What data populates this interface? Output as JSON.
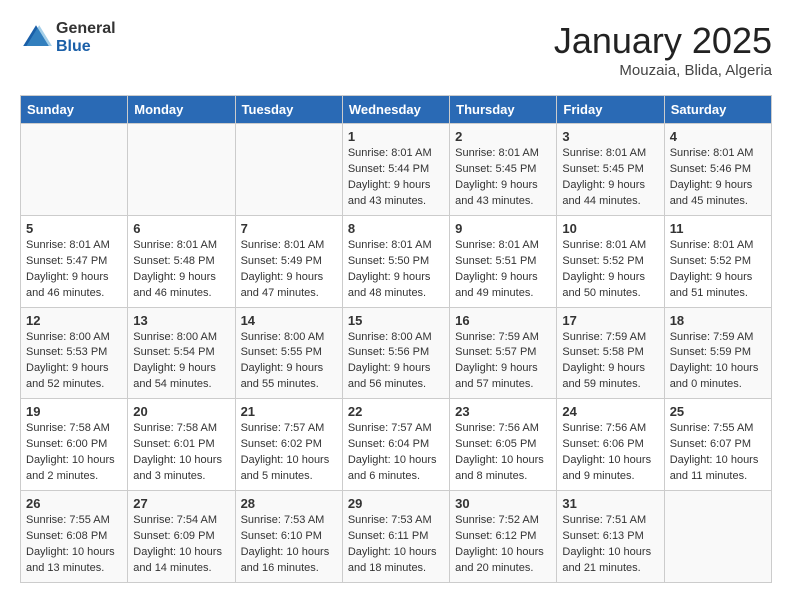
{
  "header": {
    "logo_general": "General",
    "logo_blue": "Blue",
    "title": "January 2025",
    "location": "Mouzaia, Blida, Algeria"
  },
  "days_of_week": [
    "Sunday",
    "Monday",
    "Tuesday",
    "Wednesday",
    "Thursday",
    "Friday",
    "Saturday"
  ],
  "weeks": [
    [
      {
        "day": "",
        "content": ""
      },
      {
        "day": "",
        "content": ""
      },
      {
        "day": "",
        "content": ""
      },
      {
        "day": "1",
        "content": "Sunrise: 8:01 AM\nSunset: 5:44 PM\nDaylight: 9 hours\nand 43 minutes."
      },
      {
        "day": "2",
        "content": "Sunrise: 8:01 AM\nSunset: 5:45 PM\nDaylight: 9 hours\nand 43 minutes."
      },
      {
        "day": "3",
        "content": "Sunrise: 8:01 AM\nSunset: 5:45 PM\nDaylight: 9 hours\nand 44 minutes."
      },
      {
        "day": "4",
        "content": "Sunrise: 8:01 AM\nSunset: 5:46 PM\nDaylight: 9 hours\nand 45 minutes."
      }
    ],
    [
      {
        "day": "5",
        "content": "Sunrise: 8:01 AM\nSunset: 5:47 PM\nDaylight: 9 hours\nand 46 minutes."
      },
      {
        "day": "6",
        "content": "Sunrise: 8:01 AM\nSunset: 5:48 PM\nDaylight: 9 hours\nand 46 minutes."
      },
      {
        "day": "7",
        "content": "Sunrise: 8:01 AM\nSunset: 5:49 PM\nDaylight: 9 hours\nand 47 minutes."
      },
      {
        "day": "8",
        "content": "Sunrise: 8:01 AM\nSunset: 5:50 PM\nDaylight: 9 hours\nand 48 minutes."
      },
      {
        "day": "9",
        "content": "Sunrise: 8:01 AM\nSunset: 5:51 PM\nDaylight: 9 hours\nand 49 minutes."
      },
      {
        "day": "10",
        "content": "Sunrise: 8:01 AM\nSunset: 5:52 PM\nDaylight: 9 hours\nand 50 minutes."
      },
      {
        "day": "11",
        "content": "Sunrise: 8:01 AM\nSunset: 5:52 PM\nDaylight: 9 hours\nand 51 minutes."
      }
    ],
    [
      {
        "day": "12",
        "content": "Sunrise: 8:00 AM\nSunset: 5:53 PM\nDaylight: 9 hours\nand 52 minutes."
      },
      {
        "day": "13",
        "content": "Sunrise: 8:00 AM\nSunset: 5:54 PM\nDaylight: 9 hours\nand 54 minutes."
      },
      {
        "day": "14",
        "content": "Sunrise: 8:00 AM\nSunset: 5:55 PM\nDaylight: 9 hours\nand 55 minutes."
      },
      {
        "day": "15",
        "content": "Sunrise: 8:00 AM\nSunset: 5:56 PM\nDaylight: 9 hours\nand 56 minutes."
      },
      {
        "day": "16",
        "content": "Sunrise: 7:59 AM\nSunset: 5:57 PM\nDaylight: 9 hours\nand 57 minutes."
      },
      {
        "day": "17",
        "content": "Sunrise: 7:59 AM\nSunset: 5:58 PM\nDaylight: 9 hours\nand 59 minutes."
      },
      {
        "day": "18",
        "content": "Sunrise: 7:59 AM\nSunset: 5:59 PM\nDaylight: 10 hours\nand 0 minutes."
      }
    ],
    [
      {
        "day": "19",
        "content": "Sunrise: 7:58 AM\nSunset: 6:00 PM\nDaylight: 10 hours\nand 2 minutes."
      },
      {
        "day": "20",
        "content": "Sunrise: 7:58 AM\nSunset: 6:01 PM\nDaylight: 10 hours\nand 3 minutes."
      },
      {
        "day": "21",
        "content": "Sunrise: 7:57 AM\nSunset: 6:02 PM\nDaylight: 10 hours\nand 5 minutes."
      },
      {
        "day": "22",
        "content": "Sunrise: 7:57 AM\nSunset: 6:04 PM\nDaylight: 10 hours\nand 6 minutes."
      },
      {
        "day": "23",
        "content": "Sunrise: 7:56 AM\nSunset: 6:05 PM\nDaylight: 10 hours\nand 8 minutes."
      },
      {
        "day": "24",
        "content": "Sunrise: 7:56 AM\nSunset: 6:06 PM\nDaylight: 10 hours\nand 9 minutes."
      },
      {
        "day": "25",
        "content": "Sunrise: 7:55 AM\nSunset: 6:07 PM\nDaylight: 10 hours\nand 11 minutes."
      }
    ],
    [
      {
        "day": "26",
        "content": "Sunrise: 7:55 AM\nSunset: 6:08 PM\nDaylight: 10 hours\nand 13 minutes."
      },
      {
        "day": "27",
        "content": "Sunrise: 7:54 AM\nSunset: 6:09 PM\nDaylight: 10 hours\nand 14 minutes."
      },
      {
        "day": "28",
        "content": "Sunrise: 7:53 AM\nSunset: 6:10 PM\nDaylight: 10 hours\nand 16 minutes."
      },
      {
        "day": "29",
        "content": "Sunrise: 7:53 AM\nSunset: 6:11 PM\nDaylight: 10 hours\nand 18 minutes."
      },
      {
        "day": "30",
        "content": "Sunrise: 7:52 AM\nSunset: 6:12 PM\nDaylight: 10 hours\nand 20 minutes."
      },
      {
        "day": "31",
        "content": "Sunrise: 7:51 AM\nSunset: 6:13 PM\nDaylight: 10 hours\nand 21 minutes."
      },
      {
        "day": "",
        "content": ""
      }
    ]
  ]
}
